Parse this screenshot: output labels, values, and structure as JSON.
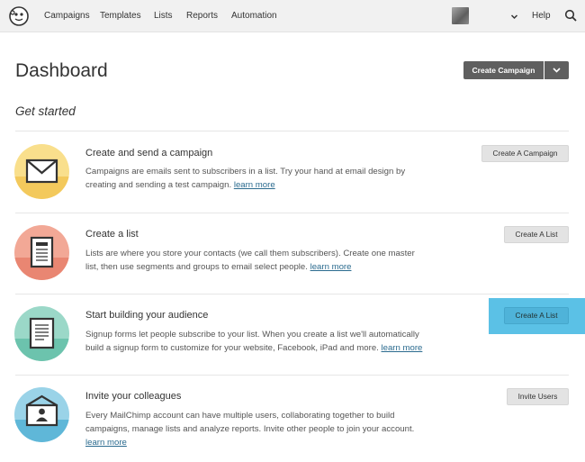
{
  "nav": {
    "items": [
      "Campaigns",
      "Templates",
      "Lists",
      "Reports",
      "Automation"
    ],
    "help": "Help"
  },
  "header": {
    "title": "Dashboard",
    "create_campaign": "Create Campaign"
  },
  "section": {
    "title": "Get started"
  },
  "cards": [
    {
      "title": "Create and send a campaign",
      "desc_line1": "Campaigns are emails sent to subscribers in a list. Try your hand at email design by",
      "desc_line2": "creating and sending a test campaign.",
      "link": "learn more",
      "button": "Create A Campaign",
      "icon": "envelope-icon"
    },
    {
      "title": "Create a list",
      "desc_line1": "Lists are where you store your contacts (we call them subscribers). Create one master",
      "desc_line2": "list, then use segments and groups to email select people.",
      "link": "learn more",
      "button": "Create A List",
      "icon": "list-document-icon"
    },
    {
      "title": "Start building your audience",
      "desc_line1": "Signup forms let people subscribe to your list. When you create a list we'll automatically",
      "desc_line2": "build a signup form to customize for your website, Facebook, iPad and more.",
      "link": "learn more",
      "button": "Create A List",
      "icon": "signup-form-icon"
    },
    {
      "title": "Invite your colleagues",
      "desc_line1": "Every MailChimp account can have multiple users, collaborating together to build",
      "desc_line2": "campaigns, manage lists and analyze reports. Invite other people to join your account.",
      "link": "learn more",
      "button": "Invite Users",
      "icon": "invite-envelope-icon"
    }
  ],
  "colors": {
    "nav_bg": "#f1f1f1",
    "primary_button": "#5f5f5f",
    "link": "#2b6b8f",
    "highlight": "#5bc1e6",
    "icon_yellow": "#f9df8c",
    "icon_red": "#f2a896",
    "icon_green": "#9bd8c8",
    "icon_blue": "#9ad3e8"
  }
}
